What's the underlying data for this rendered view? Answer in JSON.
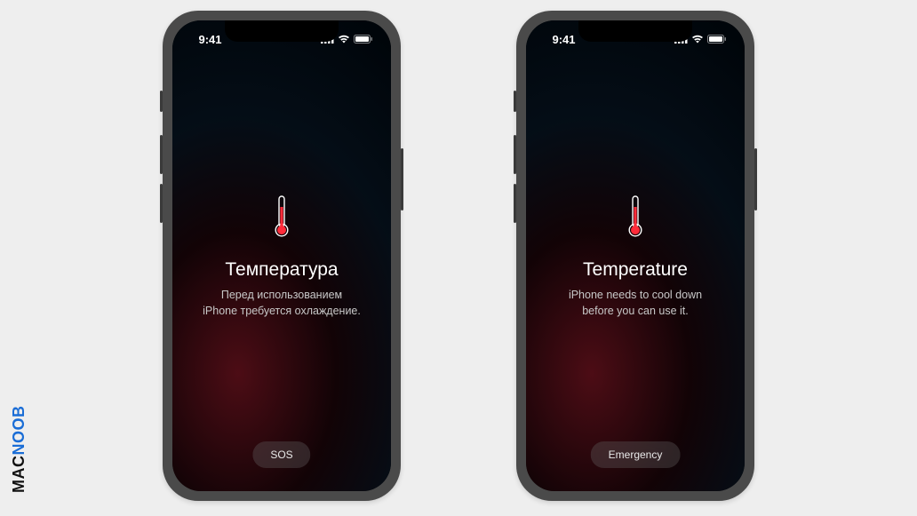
{
  "watermark": {
    "part1": "MAC",
    "part2": "NOOB"
  },
  "phones": [
    {
      "status": {
        "time": "9:41"
      },
      "heading": "Температура",
      "message": "Перед использованием\niPhone требуется охлаждение.",
      "button_label": "SOS"
    },
    {
      "status": {
        "time": "9:41"
      },
      "heading": "Temperature",
      "message": "iPhone needs to cool down\nbefore you can use it.",
      "button_label": "Emergency"
    }
  ]
}
